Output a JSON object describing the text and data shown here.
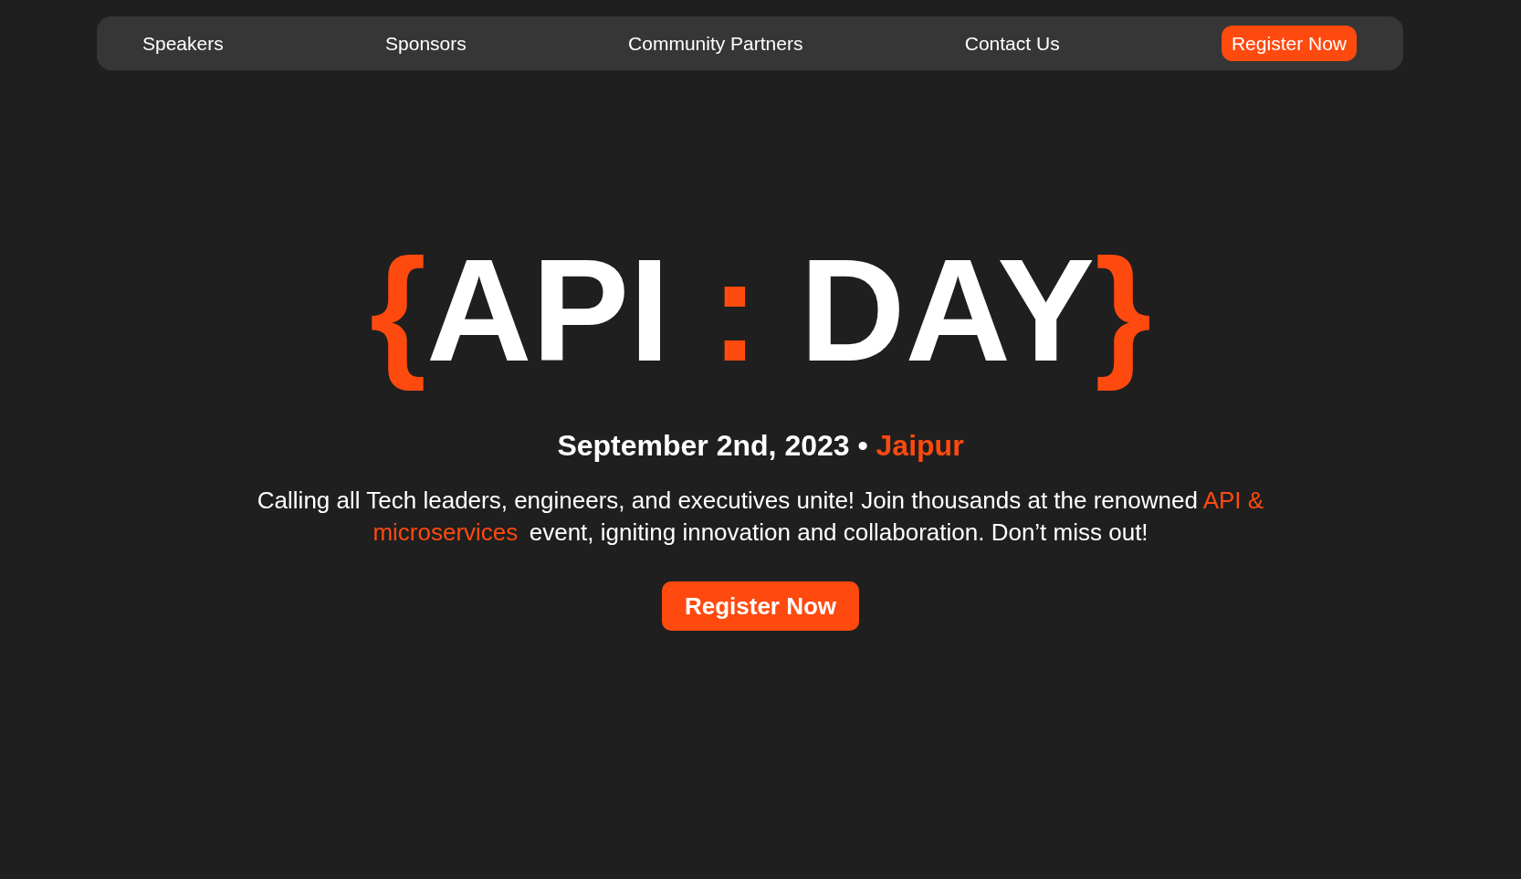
{
  "nav": {
    "links": [
      "Speakers",
      "Sponsors",
      "Community Partners",
      "Contact Us"
    ],
    "button": "Register Now"
  },
  "hero": {
    "title": [
      {
        "text": "{",
        "accent": true
      },
      {
        "text": "API",
        "accent": false
      },
      {
        "text": " : ",
        "accent": true
      },
      {
        "text": "DAY",
        "accent": false
      },
      {
        "text": "}",
        "accent": true
      }
    ],
    "date_line": [
      {
        "text": "September 2nd, 2023 • ",
        "accent": false
      },
      {
        "text": "Jaipur",
        "accent": true
      }
    ],
    "description": [
      {
        "text": "Calling all Tech leaders, engineers, and executives unite! Join thousands at the renowned ",
        "accent": false
      },
      {
        "text": "API & microservices",
        "accent": true
      },
      {
        "text": " event, igniting innovation and collaboration. Don’t miss out!",
        "accent": false
      }
    ],
    "button": "Register Now"
  }
}
